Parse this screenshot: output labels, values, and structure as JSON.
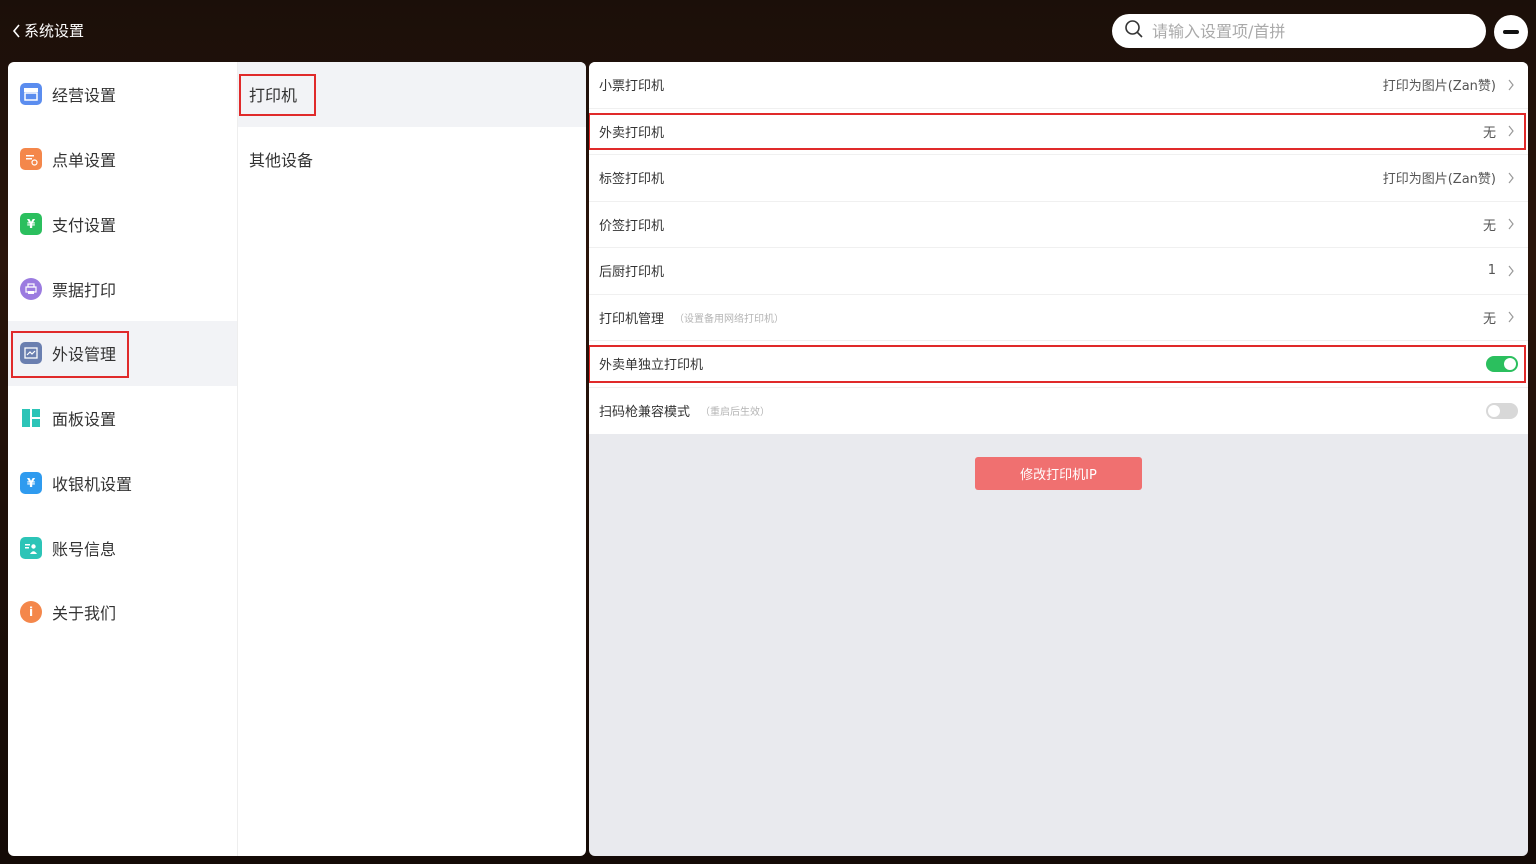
{
  "header": {
    "back_label": "系统设置",
    "search_placeholder": "请输入设置项/首拼"
  },
  "nav": {
    "items": [
      {
        "label": "经营设置",
        "icon": "store-icon",
        "color": "#5b8def"
      },
      {
        "label": "点单设置",
        "icon": "order-icon",
        "color": "#f4874b"
      },
      {
        "label": "支付设置",
        "icon": "yuan-icon",
        "color": "#2bbf5e"
      },
      {
        "label": "票据打印",
        "icon": "printer-icon",
        "color": "#9b7be0"
      },
      {
        "label": "外设管理",
        "icon": "peripheral-icon",
        "color": "#6a7fb0"
      },
      {
        "label": "面板设置",
        "icon": "panel-icon",
        "color": "#2cc4b7"
      },
      {
        "label": "收银机设置",
        "icon": "cashier-icon",
        "color": "#2f9bef"
      },
      {
        "label": "账号信息",
        "icon": "account-icon",
        "color": "#2cc4b7"
      },
      {
        "label": "关于我们",
        "icon": "info-icon",
        "color": "#f4874b"
      }
    ]
  },
  "subnav": {
    "items": [
      {
        "label": "打印机"
      },
      {
        "label": "其他设备"
      }
    ]
  },
  "settings": {
    "rows": [
      {
        "label": "小票打印机",
        "value": "打印为图片(Zan赞)"
      },
      {
        "label": "外卖打印机",
        "value": "无"
      },
      {
        "label": "标签打印机",
        "value": "打印为图片(Zan赞)"
      },
      {
        "label": "价签打印机",
        "value": "无"
      },
      {
        "label": "后厨打印机",
        "value": "1"
      },
      {
        "label": "打印机管理",
        "note": "（设置备用网络打印机）",
        "value": "无"
      },
      {
        "label": "外卖单独立打印机",
        "toggle": true
      },
      {
        "label": "扫码枪兼容模式",
        "note": "（重启后生效）",
        "toggle": false
      }
    ],
    "modify_button": "修改打印机IP"
  }
}
